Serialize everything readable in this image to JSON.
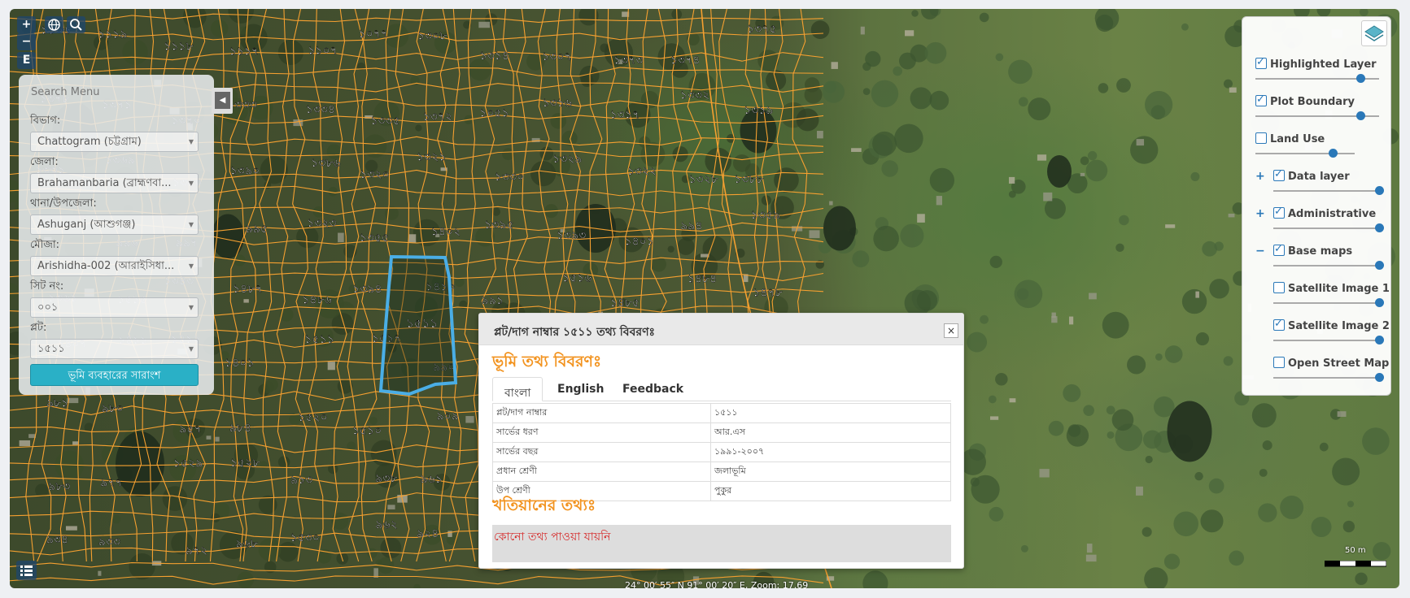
{
  "map": {
    "controls": {
      "zoom_in": "+",
      "zoom_out": "−",
      "extent": "E"
    },
    "plot_labels": [
      "১১০৬",
      "১১১৯",
      "১১১৮",
      "১১১৭",
      "১১০৭",
      "১০৭৭",
      "১৩০৮",
      "১৩১৪",
      "১৩০৭",
      "১৩৭৩",
      "১৩৭৪",
      "১৩৭৫",
      "১৩৭৮",
      "১৩৭১",
      "১৩৭০",
      "১৩৩৩",
      "১৩৩৪",
      "১৩৩৫",
      "১৩৭২",
      "১০৫১",
      "১৩১৬",
      "১৩১৭",
      "১৩৩২",
      "১৩১৯",
      "১৩৩১",
      "১৩৬৯",
      "১৩৫০",
      "১৩৯০",
      "১৩৮৬",
      "১৩২০",
      "১৩২১",
      "১৩৩০",
      "১৩২৯",
      "১৩২২",
      "১৩২৮",
      "১৩৮৮",
      "১৩৯২",
      "৯৯৬",
      "৯৯৭",
      "৯৯৫",
      "১৩২৩",
      "১৩৫৫",
      "১৪০২",
      "১৩৯৫",
      "১৩৯৩",
      "১৪০১",
      "৯৯৪",
      "১৩৫৯",
      "১৩৬১",
      "১৫১৫",
      "১৩৪৩",
      "১৪৮৭",
      "১৪৮৬",
      "১৩৯৪",
      "১৪১০",
      "৯৯১",
      "১৫১৬",
      "১৪৮৫",
      "১৪৮৪",
      "১৪৭৮",
      "১৪০৭",
      "১৪১১",
      "১৪১২",
      "১৪০১",
      "১৫১১",
      "১৫১৭",
      "৯৯০",
      "১৫১৮",
      "৯৮৭",
      "১৫১৯",
      "৯৮৮",
      "৯৮৬",
      "৯৮১",
      "৯৮০",
      "৯৫৭",
      "৯৮৪",
      "১৫২০",
      "১৫১০",
      "৯০৯",
      "৯৭৮",
      "৯১১",
      "৯৩৯",
      "৯৩৭",
      "৯৩৬",
      "৯৮৩",
      "৯৭৭",
      "১৫২৯",
      "১৫২৮",
      "৯১৩",
      "৯৩৮",
      "৯৬১",
      "৯৩৫",
      "৯২১",
      "৯৬৯",
      "৯২৩",
      "৯২৭",
      "৯৩৪",
      "৯৩৩",
      "৯৭২",
      "৯৬৮",
      "১৫৩০",
      "৯৬২",
      "৯২৪",
      "৯৩২"
    ],
    "highlighted_plot": "১৫১১",
    "coordinates": "24° 00′ 55″ N 91° 00′ 20″ E, Zoom: 17.69",
    "scale_label": "50 m"
  },
  "search": {
    "title": "Search Menu",
    "division_label": "বিভাগ:",
    "division_value": "Chattogram (চট্টগ্রাম)",
    "district_label": "জেলা:",
    "district_value": "Brahamanbaria (ব্রাহ্মণবা...",
    "upazila_label": "থানা/উপজেলা:",
    "upazila_value": "Ashuganj (আশুগঞ্জ)",
    "mouza_label": "মৌজা:",
    "mouza_value": "Arishidha-002 (আরাইসিধা...",
    "sheet_label": "সিট নং:",
    "sheet_value": "০০১",
    "plot_label": "প্লট:",
    "plot_value": "১৫১১",
    "summary_button": "ভূমি ব্যবহারের সারাংশ"
  },
  "layers": {
    "items": [
      {
        "label": "Highlighted Layer",
        "checked": true,
        "value": 0.85
      },
      {
        "label": "Plot Boundary",
        "checked": true,
        "value": 0.85
      },
      {
        "label": "Land Use",
        "checked": false,
        "value": 0.78
      },
      {
        "label": "Data layer",
        "checked": true,
        "value": 1.0
      },
      {
        "label": "Administrative",
        "checked": true,
        "value": 1.0
      },
      {
        "label": "Base maps",
        "checked": true,
        "value": 1.0
      },
      {
        "label": "Satellite Image 1",
        "checked": false,
        "value": 1.0
      },
      {
        "label": "Satellite Image 2",
        "checked": true,
        "value": 1.0
      },
      {
        "label": "Open Street Map",
        "checked": false,
        "value": 1.0
      }
    ]
  },
  "popup": {
    "title": "প্লট/দাগ নাম্বার ১৫১১ তথ্য বিবরণঃ",
    "close": "×",
    "land_heading": "ভূমি তথ্য বিবরণঃ",
    "tabs": [
      "বাংলা",
      "English",
      "Feedback"
    ],
    "rows": [
      {
        "key": "প্লট/দাগ নাম্বার",
        "value": "১৫১১"
      },
      {
        "key": "সার্ভের ধরণ",
        "value": "আর.এস"
      },
      {
        "key": "সার্ভের বছর",
        "value": "১৯৯১-২০০৭"
      },
      {
        "key": "প্রধান শ্রেণী",
        "value": "জলাভূমি"
      },
      {
        "key": "উপ শ্রেণী",
        "value": "পুকুর"
      }
    ],
    "khatian_heading": "খতিয়ানের তথ্যঃ",
    "no_info": "কোনো তথ্য পাওয়া যায়নি"
  },
  "colors": {
    "plot_boundary": "#f5a030",
    "highlight": "#4aaee6",
    "accent": "#2ab0c6",
    "heading": "#f2931f",
    "error": "#d62b2b"
  }
}
